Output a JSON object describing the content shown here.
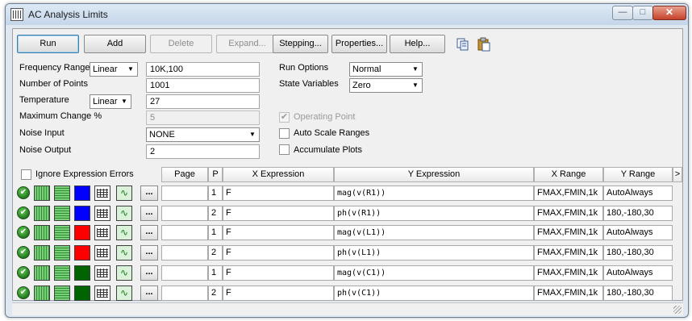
{
  "window": {
    "title": "AC Analysis Limits",
    "minimize_glyph": "—",
    "maximize_glyph": "□",
    "close_glyph": "✕"
  },
  "toolbar": {
    "run": "Run",
    "add": "Add",
    "delete": "Delete",
    "expand": "Expand...",
    "stepping": "Stepping...",
    "properties": "Properties...",
    "help": "Help...",
    "copy_icon": "copy-icon",
    "paste_icon": "paste-icon"
  },
  "params": {
    "frequency_range_label": "Frequency Range",
    "frequency_range_type": "Linear",
    "frequency_range_value": "10K,100",
    "number_of_points_label": "Number of Points",
    "number_of_points_value": "1001",
    "temperature_label": "Temperature",
    "temperature_type": "Linear",
    "temperature_value": "27",
    "maximum_change_label": "Maximum Change %",
    "maximum_change_value": "5",
    "noise_input_label": "Noise Input",
    "noise_input_value": "NONE",
    "noise_output_label": "Noise Output",
    "noise_output_value": "2"
  },
  "options": {
    "run_options_label": "Run Options",
    "run_options_value": "Normal",
    "state_variables_label": "State Variables",
    "state_variables_value": "Zero",
    "operating_point_label": "Operating Point",
    "operating_point_checked": true,
    "auto_scale_label": "Auto Scale Ranges",
    "auto_scale_checked": false,
    "accumulate_label": "Accumulate Plots",
    "accumulate_checked": false
  },
  "grid": {
    "ignore_errors_label": "Ignore Expression Errors",
    "headers": {
      "page": "Page",
      "p": "P",
      "x_expression": "X Expression",
      "y_expression": "Y Expression",
      "x_range": "X Range",
      "y_range": "Y Range",
      "more": ">"
    },
    "ellipsis": "...",
    "check_glyph": "✔",
    "wave_glyph": "∿",
    "rows": [
      {
        "color": "#0000ff",
        "page": "",
        "p": "1",
        "x_expr": "F",
        "y_expr": "mag(v(R1))",
        "x_range": "FMAX,FMIN,1k",
        "y_range": "AutoAlways"
      },
      {
        "color": "#0000ff",
        "page": "",
        "p": "2",
        "x_expr": "F",
        "y_expr": "ph(v(R1))",
        "x_range": "FMAX,FMIN,1k",
        "y_range": "180,-180,30"
      },
      {
        "color": "#ff0000",
        "page": "",
        "p": "1",
        "x_expr": "F",
        "y_expr": "mag(v(L1))",
        "x_range": "FMAX,FMIN,1k",
        "y_range": "AutoAlways"
      },
      {
        "color": "#ff0000",
        "page": "",
        "p": "2",
        "x_expr": "F",
        "y_expr": "ph(v(L1))",
        "x_range": "FMAX,FMIN,1k",
        "y_range": "180,-180,30"
      },
      {
        "color": "#006400",
        "page": "",
        "p": "1",
        "x_expr": "F",
        "y_expr": "mag(v(C1))",
        "x_range": "FMAX,FMIN,1k",
        "y_range": "AutoAlways"
      },
      {
        "color": "#006400",
        "page": "",
        "p": "2",
        "x_expr": "F",
        "y_expr": "ph(v(C1))",
        "x_range": "FMAX,FMIN,1k",
        "y_range": "180,-180,30"
      }
    ]
  }
}
